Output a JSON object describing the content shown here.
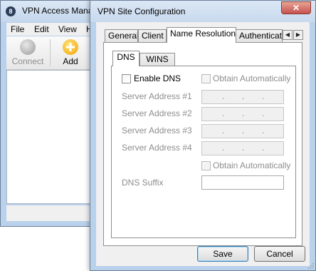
{
  "background_window": {
    "title": "VPN Access Manag",
    "app_icon_glyph": "8",
    "menu": [
      "File",
      "Edit",
      "View",
      "H"
    ],
    "toolbar": {
      "connect_label": "Connect",
      "add_label": "Add"
    }
  },
  "dialog": {
    "title": "VPN Site Configuration",
    "close_glyph": "✕",
    "tabs": [
      "General",
      "Client",
      "Name Resolution",
      "Authenticati"
    ],
    "active_tab": "Name Resolution",
    "scroll_left": "◀",
    "scroll_right": "▶",
    "subtabs": [
      "DNS",
      "WINS"
    ],
    "active_subtab": "DNS",
    "dns": {
      "enable_dns_label": "Enable DNS",
      "enable_dns_checked": false,
      "obtain_auto_label_1": "Obtain Automatically",
      "server_labels": [
        "Server Address #1",
        "Server Address #2",
        "Server Address #3",
        "Server Address #4"
      ],
      "ip_dot": ".",
      "obtain_auto_label_2": "Obtain Automatically",
      "suffix_label": "DNS Suffix",
      "suffix_value": ""
    },
    "buttons": {
      "save": "Save",
      "cancel": "Cancel"
    }
  },
  "colors": {
    "window_frame": "#b9d1ea",
    "close_button": "#c75050",
    "disabled_text": "#8d8d8d"
  }
}
